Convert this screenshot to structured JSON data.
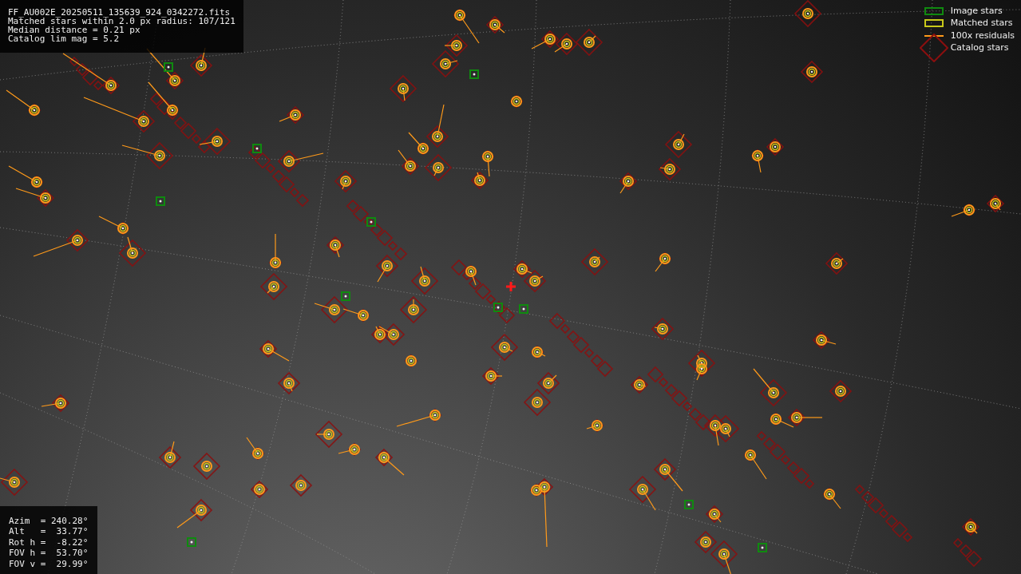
{
  "file_info": {
    "lines": [
      "FF_AU002E_20250511_135639_924_0342272.fits",
      "Matched stars within 2.0 px radius: 107/121",
      "Median distance = 0.21 px",
      "Catalog lim mag = 5.2"
    ]
  },
  "legend": {
    "items": [
      {
        "kind": "image",
        "label": "Image stars",
        "color": "#0f8a0f"
      },
      {
        "kind": "matched",
        "label": "Matched stars",
        "color": "#c8c81a"
      },
      {
        "kind": "residual",
        "label": "100x residuals",
        "color": "#ff9a1a"
      },
      {
        "kind": "catalog",
        "label": "Catalog stars",
        "color": "#8a0f0f"
      }
    ]
  },
  "pointing": {
    "lines": [
      "Azim  = 240.28°",
      "Alt   =  33.77°",
      "Rot h =  -8.22°",
      "FOV h =  53.70°",
      "FOV v =  29.99°"
    ]
  }
}
